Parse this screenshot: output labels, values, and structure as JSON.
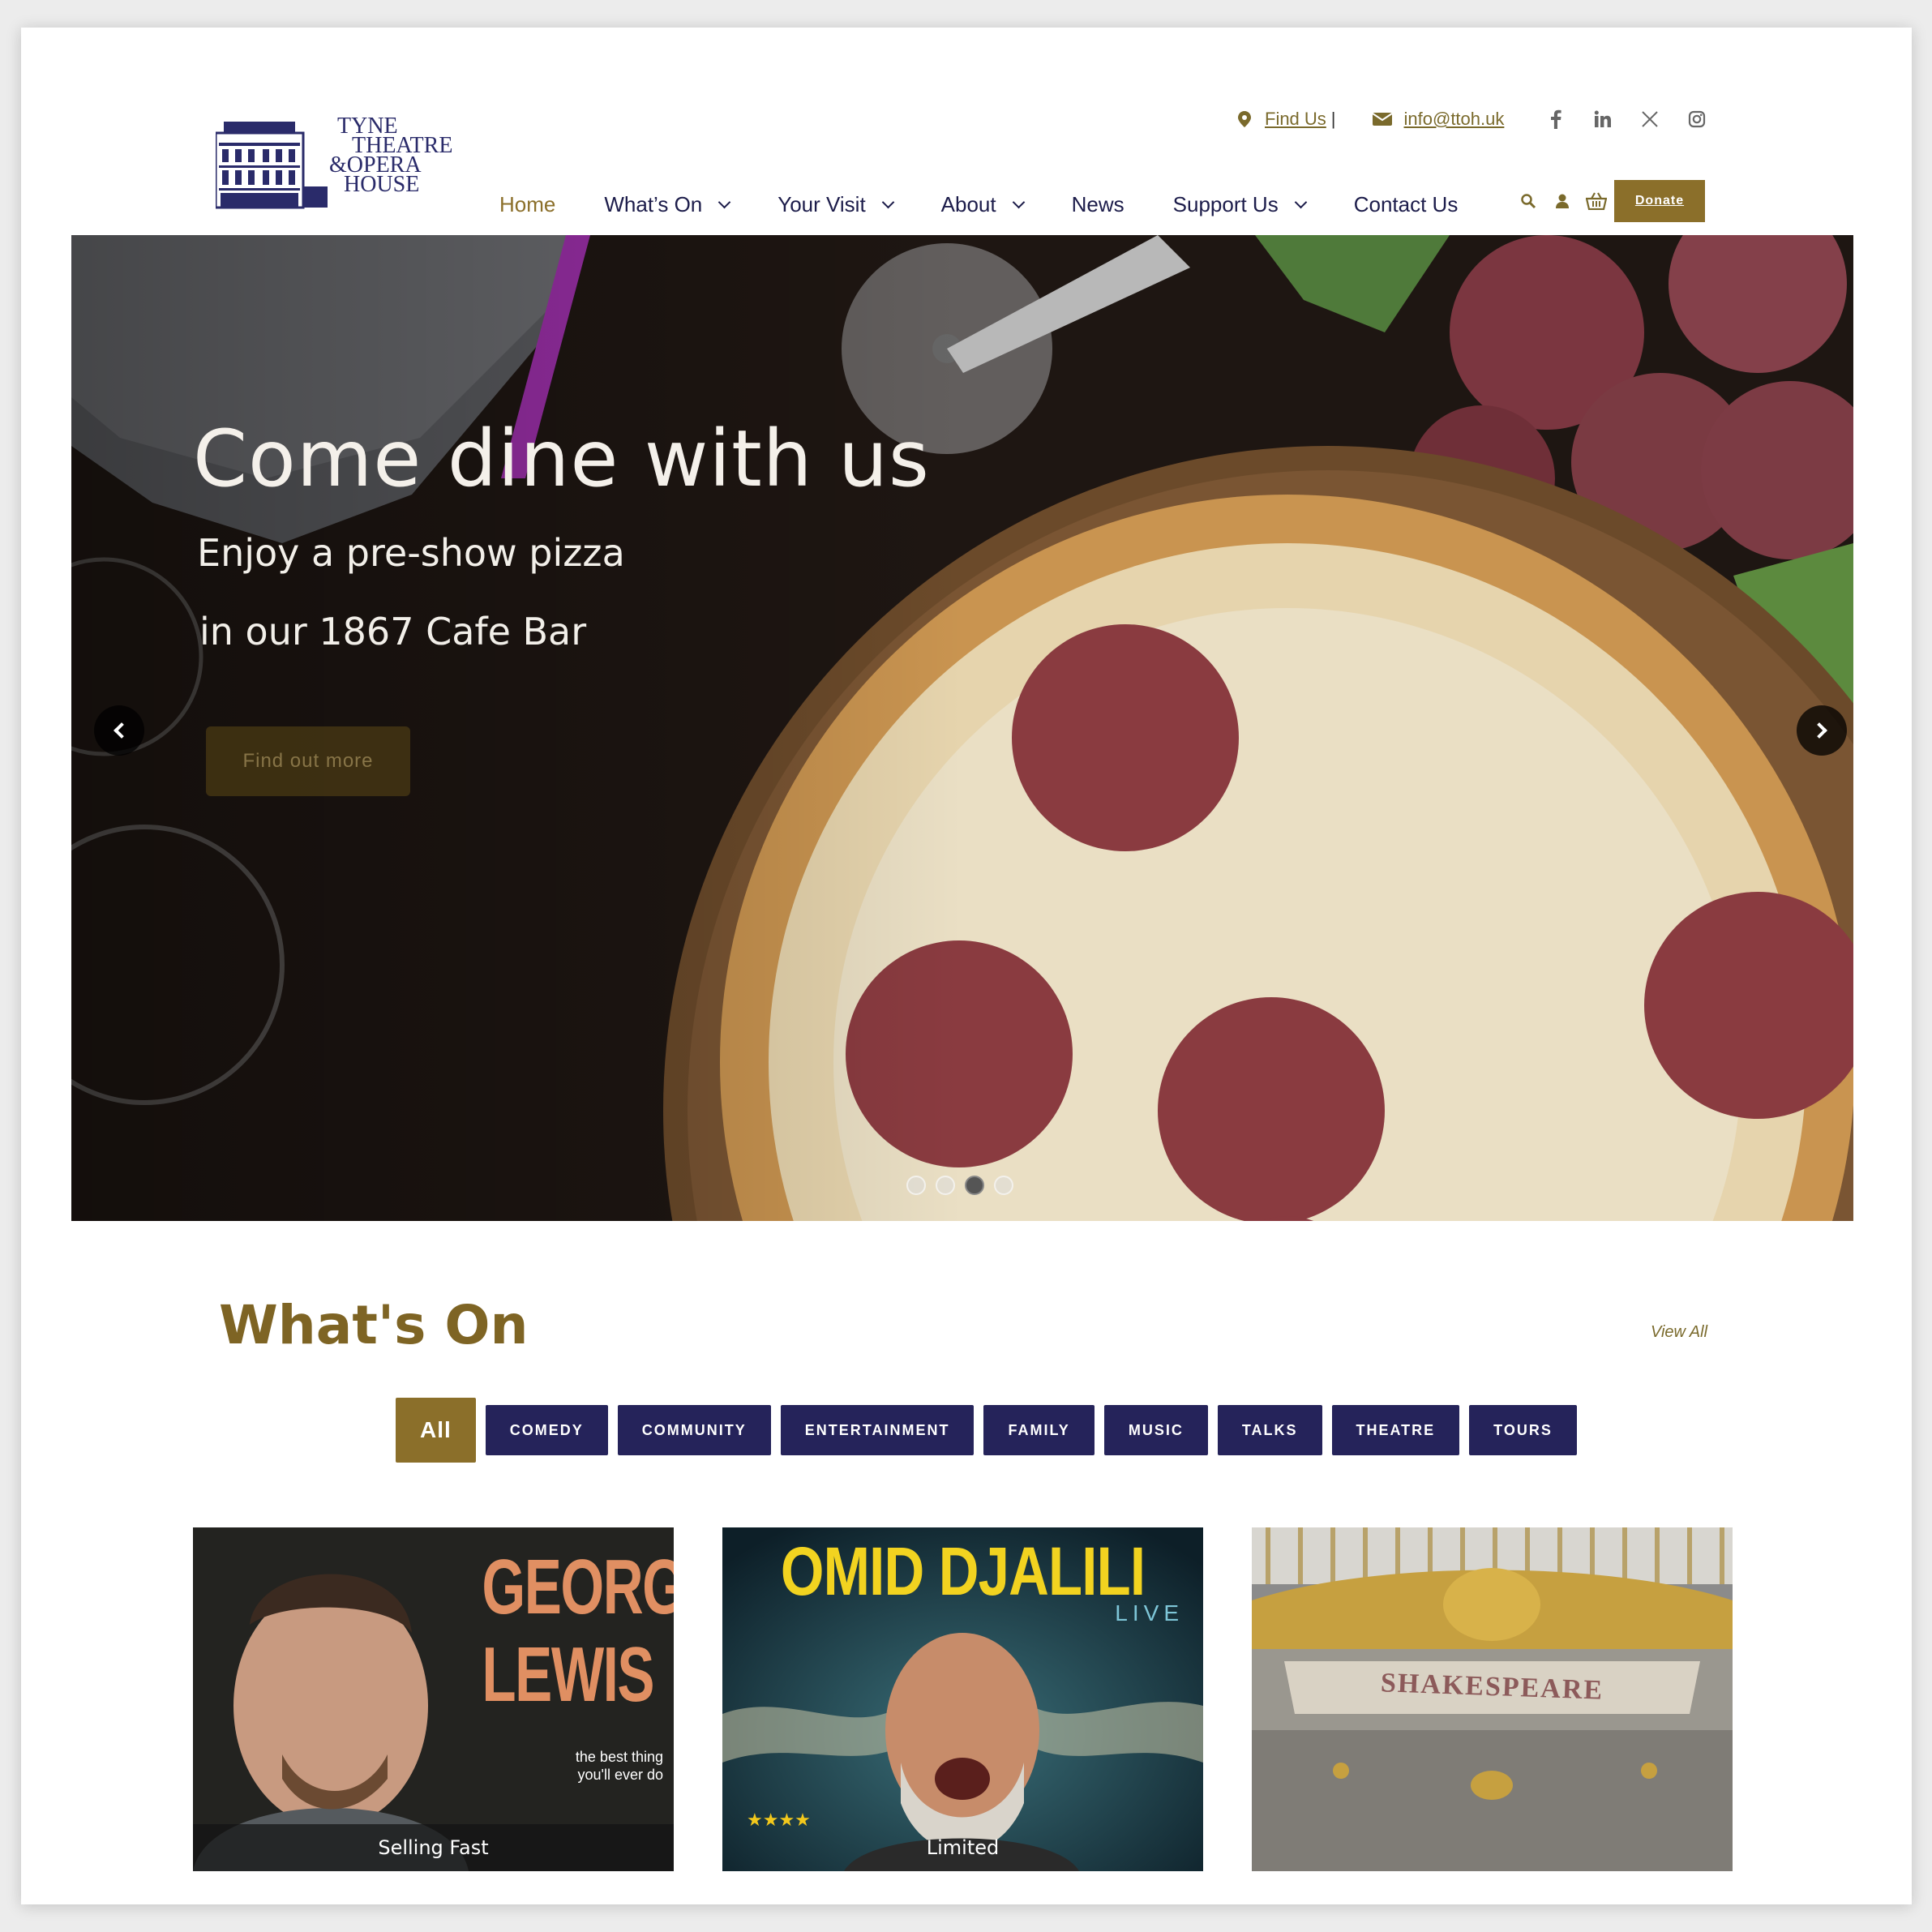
{
  "logo": {
    "line1": "TYNE",
    "line2": "THEATRE",
    "line3": "&OPERA",
    "line4": "HOUSE"
  },
  "topbar": {
    "find_us": "Find Us",
    "separator": "|",
    "email": "info@ttoh.uk",
    "social_icons": [
      "facebook-icon",
      "linkedin-icon",
      "x-icon",
      "instagram-icon"
    ]
  },
  "nav": {
    "items": [
      {
        "label": "Home",
        "active": true,
        "dropdown": false
      },
      {
        "label": "What’s On",
        "dropdown": true
      },
      {
        "label": "Your Visit",
        "dropdown": true
      },
      {
        "label": "About",
        "dropdown": true
      },
      {
        "label": "News",
        "dropdown": false
      },
      {
        "label": "Support Us",
        "dropdown": true
      },
      {
        "label": "Contact Us",
        "dropdown": false
      }
    ],
    "donate": "Donate"
  },
  "hero": {
    "title": "Come dine with us",
    "subtitle1": "Enjoy a pre-show pizza",
    "subtitle2": "in our 1867 Cafe Bar",
    "cta": "Find out more",
    "slide_count": 4,
    "active_slide": 3
  },
  "whats_on": {
    "title": "What's On",
    "view_all": "View All",
    "filters": [
      "All",
      "COMEDY",
      "COMMUNITY",
      "ENTERTAINMENT",
      "FAMILY",
      "MUSIC",
      "TALKS",
      "THEATRE",
      "TOURS"
    ],
    "cards": [
      {
        "poster_title_1": "GEORGE",
        "poster_title_2": "LEWIS",
        "poster_tagline_1": "the best thing",
        "poster_tagline_2": "you'll ever do",
        "badge": "Selling Fast"
      },
      {
        "poster_title_1": "OMID DJALILI",
        "poster_title_2": "LIVE",
        "badge": "Limited"
      },
      {
        "poster_title_1": "SHAKESPEARE"
      }
    ]
  },
  "colors": {
    "gold": "#8b6f2a",
    "navy": "#25235a",
    "heading_gold": "#7e6424"
  }
}
